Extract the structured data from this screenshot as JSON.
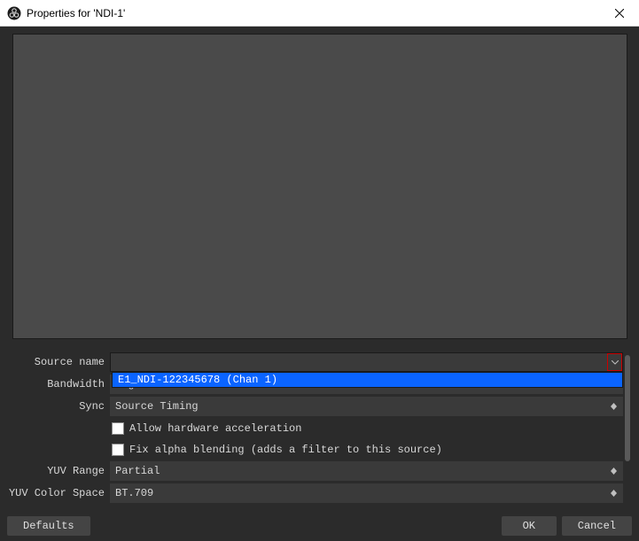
{
  "window": {
    "title": "Properties for 'NDI-1'"
  },
  "form": {
    "source_name": {
      "label": "Source name",
      "value": ""
    },
    "dropdown_option": "E1_NDI-122345678 (Chan 1)",
    "bandwidth": {
      "label": "Bandwidth",
      "value": "Highest"
    },
    "sync": {
      "label": "Sync",
      "value": "Source Timing"
    },
    "allow_hw_accel": {
      "label": "Allow hardware acceleration",
      "checked": false
    },
    "fix_alpha": {
      "label": "Fix alpha blending (adds a filter to this source)",
      "checked": false
    },
    "yuv_range": {
      "label": "YUV Range",
      "value": "Partial"
    },
    "yuv_color_space": {
      "label": "YUV Color Space",
      "value": "BT.709"
    }
  },
  "buttons": {
    "defaults": "Defaults",
    "ok": "OK",
    "cancel": "Cancel"
  }
}
